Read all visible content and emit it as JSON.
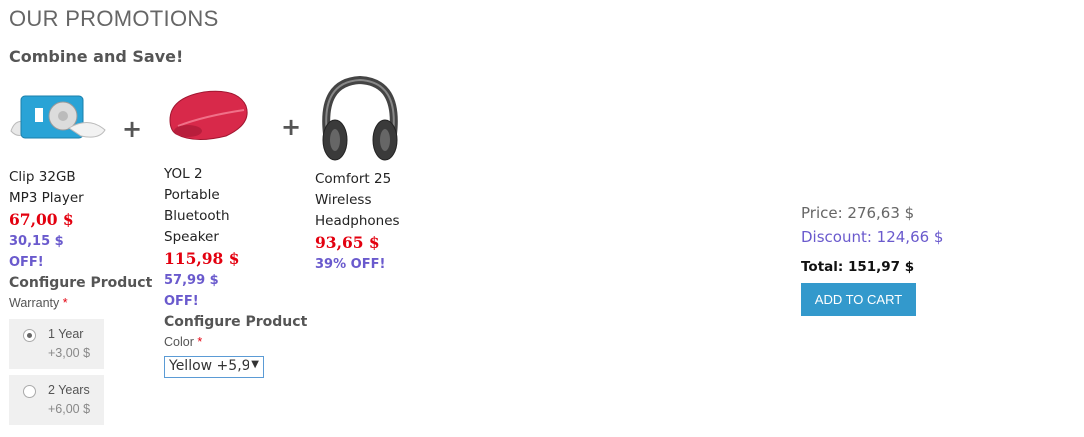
{
  "header": {
    "title": "OUR PROMOTIONS",
    "subtitle": "Combine and Save!"
  },
  "separator": "+",
  "products": [
    {
      "name_lines": [
        "Clip 32GB",
        "MP3 Player"
      ],
      "price": "67,00 $",
      "discount_lines": [
        "30,15 $",
        "OFF!"
      ],
      "configure": {
        "title": "Configure Product",
        "option_label": "Warranty",
        "required_mark": "*",
        "options": [
          {
            "name": "1 Year",
            "price": "+3,00 $",
            "checked": true
          },
          {
            "name": "2 Years",
            "price": "+6,00 $",
            "checked": false
          }
        ]
      }
    },
    {
      "name_lines": [
        "YOL 2",
        "Portable",
        "Bluetooth",
        "Speaker"
      ],
      "price": "115,98 $",
      "discount_lines": [
        "57,99 $",
        "OFF!"
      ],
      "configure": {
        "title": "Configure Product",
        "option_label": "Color",
        "required_mark": "*",
        "selected": "Yellow +5,9",
        "arrow": "▼"
      }
    },
    {
      "name_lines": [
        "Comfort 25",
        "Wireless",
        "Headphones"
      ],
      "price": "93,65 $",
      "discount_lines": [
        "39% OFF!"
      ]
    }
  ],
  "summary": {
    "price": "Price: 276,63 $",
    "discount": "Discount: 124,66 $",
    "total": "Total: 151,97 $",
    "button": "ADD TO CART"
  },
  "colors": {
    "price_red": "#e3000f",
    "discount_purple": "#6a5acd",
    "button_blue": "#3399cc"
  }
}
